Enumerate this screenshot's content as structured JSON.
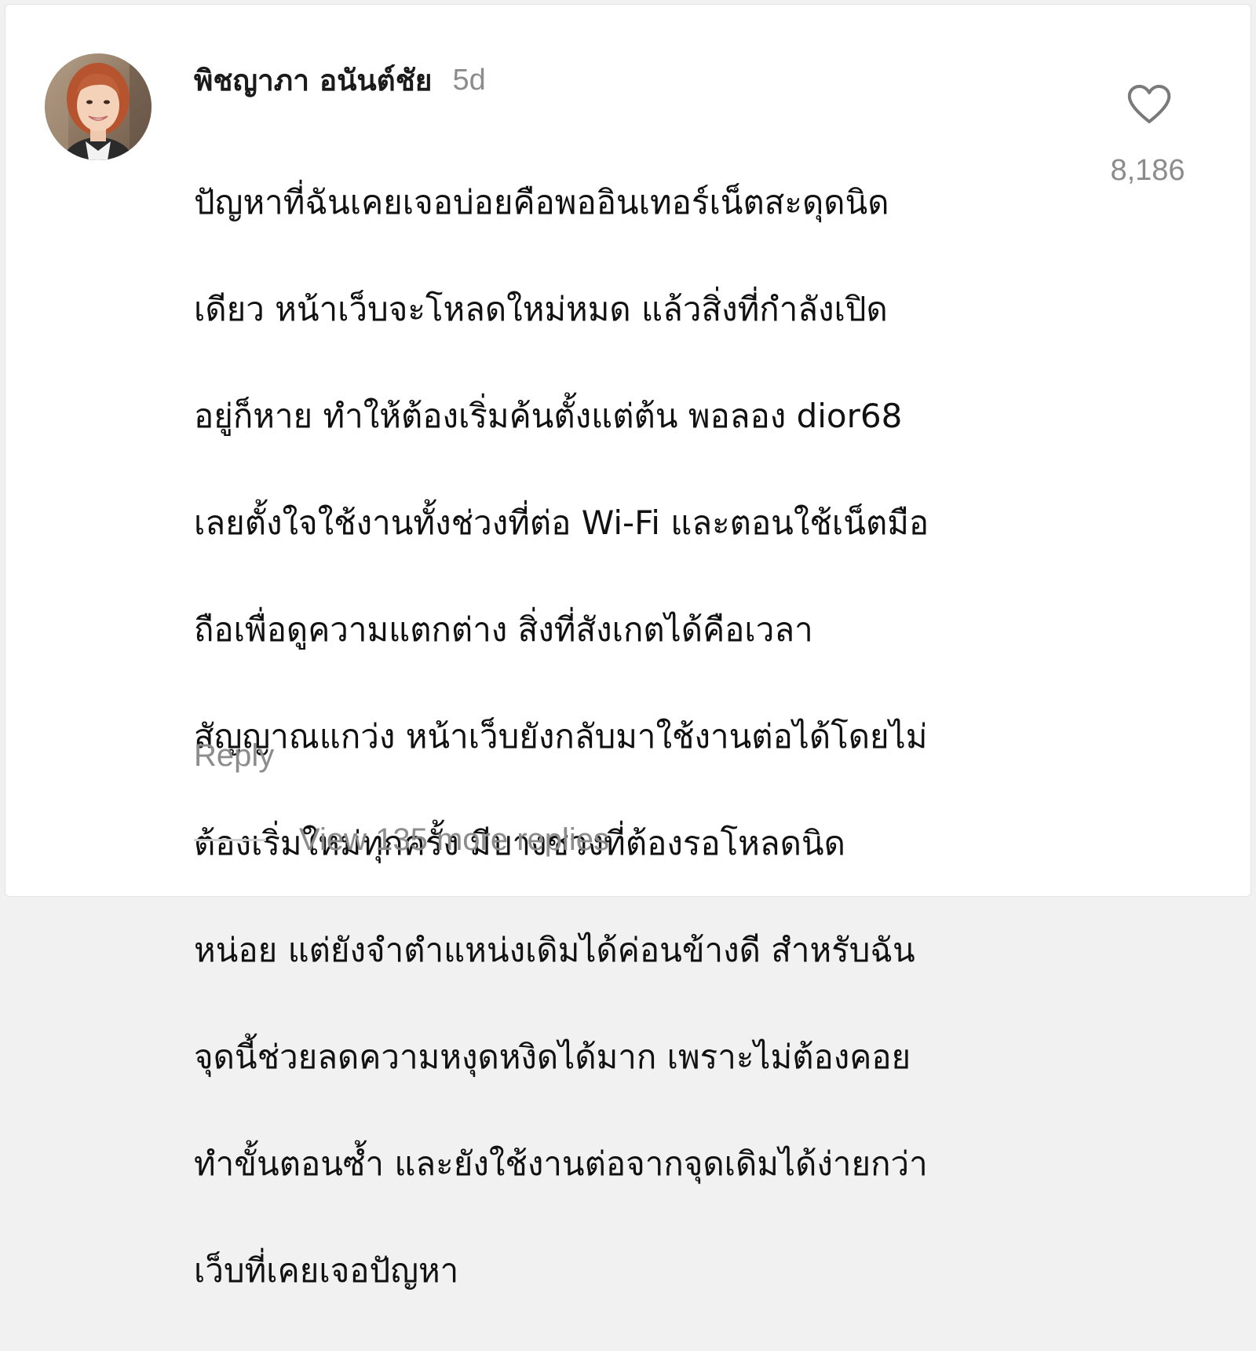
{
  "comment": {
    "username": "พิชญาภา อนันต์ชัย",
    "age": "5d",
    "avatar_icon": "profile-photo-avatar",
    "lines": [
      "ปัญหาที่ฉันเคยเจอบ่อยคือพออินเทอร์เน็ตสะดุดนิด",
      "เดียว หน้าเว็บจะโหลดใหม่หมด แล้วสิ่งที่กำลังเปิด",
      "อยู่ก็หาย ทำให้ต้องเริ่มค้นตั้งแต่ต้น พอลอง dior68",
      "เลยตั้งใจใช้งานทั้งช่วงที่ต่อ Wi-Fi และตอนใช้เน็ตมือ",
      "ถือเพื่อดูความแตกต่าง สิ่งที่สังเกตได้คือเวลา",
      "สัญญาณแกว่ง หน้าเว็บยังกลับมาใช้งานต่อได้โดยไม่",
      "ต้องเริ่มใหม่ทุกครั้ง มีบางช่วงที่ต้องรอโหลดนิด",
      "หน่อย แต่ยังจำตำแหน่งเดิมได้ค่อนข้างดี สำหรับฉัน",
      "จุดนี้ช่วยลดความหงุดหงิดได้มาก เพราะไม่ต้องคอย",
      "ทำขั้นตอนซ้ำ และยังใช้งานต่อจากจุดเดิมได้ง่ายกว่า",
      "เว็บที่เคยเจอปัญหา"
    ],
    "like_icon": "heart-outline-icon",
    "like_count": "8,186",
    "reply_label": "Reply",
    "view_replies_label": "View 135 more replies"
  },
  "colors": {
    "text_primary": "#111111",
    "text_secondary": "#8c8c8c",
    "background": "#ffffff"
  }
}
